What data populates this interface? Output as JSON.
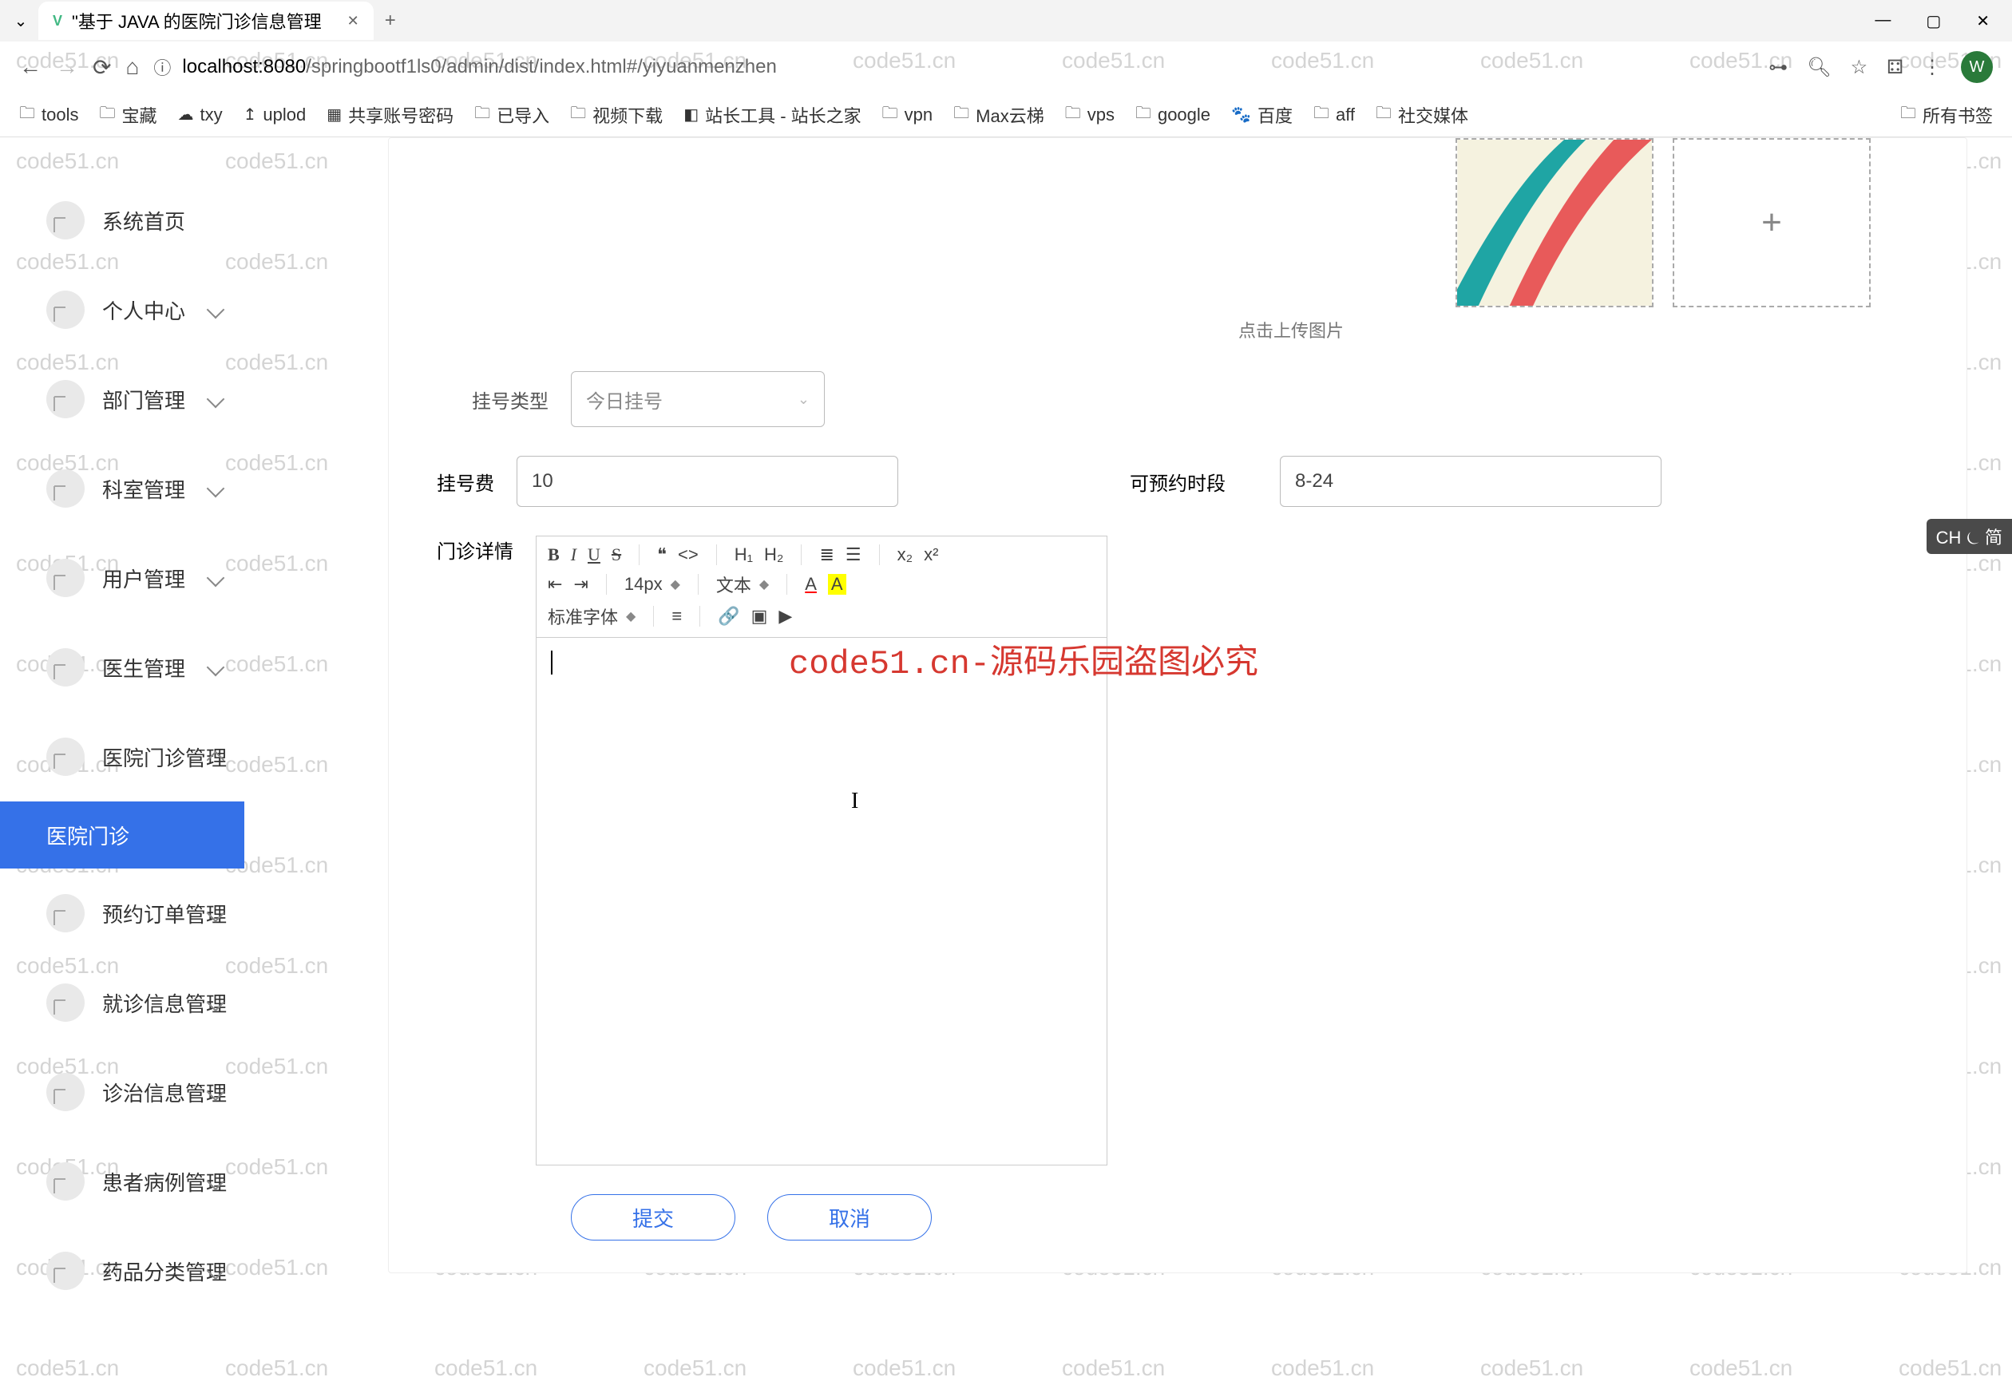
{
  "browser": {
    "tabTitle": "\"基于 JAVA 的医院门诊信息管理",
    "url": {
      "host": "localhost:8080",
      "path": "/springbootf1ls0/admin/dist/index.html#/yiyuanmenzhen"
    },
    "avatar": "W",
    "windowButtons": {
      "min": "—",
      "max": "▢",
      "close": "✕"
    }
  },
  "bookmarks": {
    "items": [
      "tools",
      "宝藏",
      "txy",
      "uplod",
      "共享账号密码",
      "已导入",
      "视频下载",
      "站长工具 - 站长之家",
      "vpn",
      "Max云梯",
      "vps",
      "google",
      "百度",
      "aff",
      "社交媒体"
    ],
    "all": "所有书签"
  },
  "sidebar": {
    "items": [
      {
        "label": "系统首页",
        "sub": false
      },
      {
        "label": "个人中心",
        "sub": true
      },
      {
        "label": "部门管理",
        "sub": true
      },
      {
        "label": "科室管理",
        "sub": true
      },
      {
        "label": "用户管理",
        "sub": true
      },
      {
        "label": "医生管理",
        "sub": true
      },
      {
        "label": "医院门诊管理",
        "sub": true,
        "expanded": true
      },
      {
        "label": "预约订单管理",
        "sub": true
      },
      {
        "label": "就诊信息管理",
        "sub": true
      },
      {
        "label": "诊治信息管理",
        "sub": true
      },
      {
        "label": "患者病例管理",
        "sub": true
      },
      {
        "label": "药品分类管理",
        "sub": true
      }
    ],
    "activeSub": "医院门诊"
  },
  "form": {
    "imgHint": "点击上传图片",
    "regTypeLabel": "挂号类型",
    "regTypeValue": "今日挂号",
    "feeLabel": "挂号费",
    "feeValue": "10",
    "timeLabel": "可预约时段",
    "timeValue": "8-24",
    "detailLabel": "门诊详情",
    "submit": "提交",
    "cancel": "取消"
  },
  "rte": {
    "fontSize": "14px",
    "textLabel": "文本",
    "fontLabel": "标准字体"
  },
  "ime": "CH ⏾ 简",
  "watermark": {
    "text": "code51.cn",
    "red": "code51.cn-源码乐园盗图必究"
  }
}
